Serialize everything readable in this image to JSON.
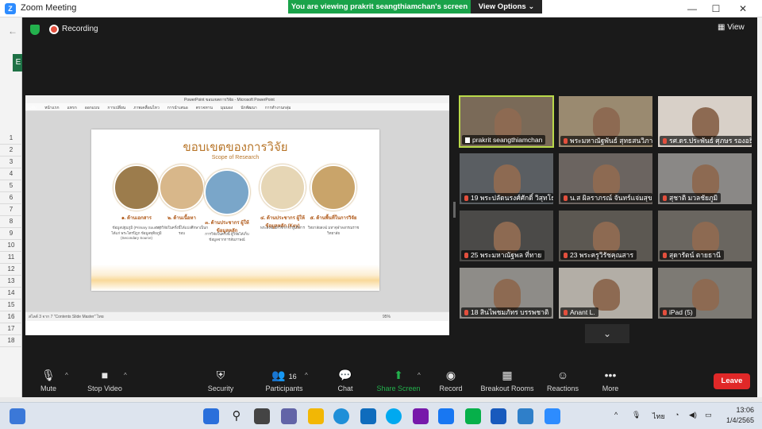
{
  "window": {
    "title": "Zoom Meeting",
    "banner": "You are viewing prakrit seangthiamchan's screen",
    "view_options": "View Options ⌄"
  },
  "zoom_top": {
    "recording": "Recording",
    "view": "View"
  },
  "excel_rows": [
    "1",
    "2",
    "3",
    "4",
    "5",
    "6",
    "7",
    "8",
    "9",
    "10",
    "11",
    "12",
    "13",
    "14",
    "15",
    "16",
    "17",
    "18"
  ],
  "shared": {
    "ppt_title": "PowerPoint ขอบเขตการวิจัย - Microsoft PowerPoint",
    "ribbon_tabs": [
      "แฟ้ม",
      "หน้าแรก",
      "แทรก",
      "ออกแบบ",
      "การเปลี่ยน",
      "ภาพเคลื่อนไหว",
      "การนำเสนอ",
      "ตรวจทาน",
      "มุมมอง",
      "นักพัฒนา",
      "การทำงานกลุ่ม"
    ],
    "slide": {
      "title": "ขอบเขตของการวิจัย",
      "subtitle": "Scope of Research",
      "items": [
        {
          "head": "๑. ด้านเอกสาร",
          "body": "ข้อมูลปฐมภูมิ (Primary Source) ได้แก่ พระไตรปิฎก ข้อมูลทุติยภูมิ (Secondary Source)"
        },
        {
          "head": "๒. ด้านเนื้อหา",
          "body": "การวิจัยในครั้งนี้ได้แบ่งศึกษาเป็นกรอบ"
        },
        {
          "head": "๓. ด้านประชากร ผู้ให้ข้อมูลหลัก",
          "body": "การวิจัยในครั้งนี้ ผู้วิจัยได้เก็บข้อมูลจากการสัมภาษณ์"
        },
        {
          "head": "๔. ด้านประชากร ผู้ให้ข้อมูลหลัก (Key)",
          "body": "พระสงฆ์ นักวิชาการ ผู้บริหาร"
        },
        {
          "head": "๕. ด้านพื้นที่ในการวิจัย",
          "body": "วิทยาลัยสงฆ์ มหาจุฬาลงกรณราชวิทยาลัย"
        }
      ]
    },
    "status": "สไลด์ 3 จาก 7   \"Contents Slide Master\"   ไทย",
    "zoom_pct": "95%"
  },
  "participants": [
    {
      "name": "prakrit seangthiamchan",
      "pinned": true,
      "muted": false
    },
    {
      "name": "พระมหาณัฐพันธ์ สุทธสนวิภาส",
      "pinned": false,
      "muted": true
    },
    {
      "name": "รศ.ดร.ประพันธ์ ศุภษร รองอธิการบดี",
      "pinned": false,
      "muted": true
    },
    {
      "name": "19 พระปลัดนรงศ์ศักดิ์ วิสุทโธ",
      "pinned": false,
      "muted": true
    },
    {
      "name": "น.ส ผิลราภรณ์ จันทร์แจ่มสุข",
      "pinned": false,
      "muted": true
    },
    {
      "name": "สุชาติ มวลชัยภูมิ",
      "pinned": false,
      "muted": true
    },
    {
      "name": "25  พระมหาณัฐพล  ที่ทาย",
      "pinned": false,
      "muted": true
    },
    {
      "name": "23  พระครูวิรัชคุณสาร",
      "pinned": false,
      "muted": true
    },
    {
      "name": "สุดารัตน์ ตายธานี",
      "pinned": false,
      "muted": true
    },
    {
      "name": "18 สินไพชมภัทร บรรพชาติ",
      "pinned": false,
      "muted": true
    },
    {
      "name": "Anant L.",
      "pinned": false,
      "muted": true
    },
    {
      "name": "iPad (5)",
      "pinned": false,
      "muted": true
    }
  ],
  "toolbar": {
    "mute": "Mute",
    "stop_video": "Stop Video",
    "security": "Security",
    "participants": "Participants",
    "participants_count": "16",
    "chat": "Chat",
    "share_screen": "Share Screen",
    "record": "Record",
    "breakout": "Breakout Rooms",
    "reactions": "Reactions",
    "more": "More",
    "leave": "Leave"
  },
  "taskbar": {
    "lang": "ไทย",
    "time": "13:06",
    "date": "1/4/2565"
  },
  "colors": {
    "banner_green": "#1aa34a",
    "leave_red": "#e02828",
    "active_border": "#b9d94a",
    "share_green": "#23b14d"
  }
}
